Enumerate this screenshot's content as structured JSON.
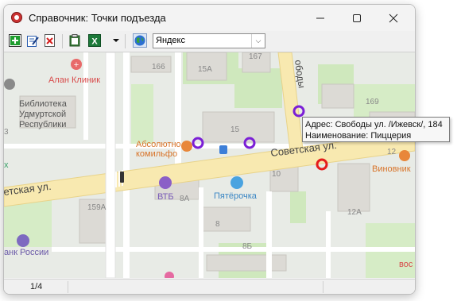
{
  "window": {
    "title": "Справочник: Точки подъезда"
  },
  "toolbar": {
    "provider_select": {
      "value": "Яндекс"
    }
  },
  "map": {
    "labels": {
      "alan_clinic": "Алан Клиник",
      "library": "Библиотека\nУдмуртской\nРеспублики",
      "absolutno": "Абсолютно\nкомильфо",
      "vtb": "ВТБ",
      "pyaterochka": "Пятёрочка",
      "bank_russia": "анк России",
      "vinovnik": "Виновник",
      "street_sovetskaya_right": "Советская ул.",
      "street_sovetskaya_left": "етская ул.",
      "street_svobody": "ободы",
      "x_label": "х",
      "bottom_right": "вос"
    },
    "houses": {
      "h166": "166",
      "h15A": "15А",
      "h167": "167",
      "h15": "15",
      "h10": "10",
      "h159A": "159А",
      "h8A": "8А",
      "h8": "8",
      "h8B": "8Б",
      "h12A": "12А",
      "h169": "169",
      "h12": "12",
      "h3": "3"
    }
  },
  "tooltip": {
    "line1": "Адрес: Свободы ул. /Ижевск/, 184",
    "line2": "Наименование: Пиццерия"
  },
  "status": {
    "page": "1/4"
  },
  "colors": {
    "marker_purple": "#7b1fd6",
    "marker_red": "#e51c1c",
    "road": "#ffffff",
    "main_road": "#f6e6a6",
    "park": "#c8e6b6"
  }
}
